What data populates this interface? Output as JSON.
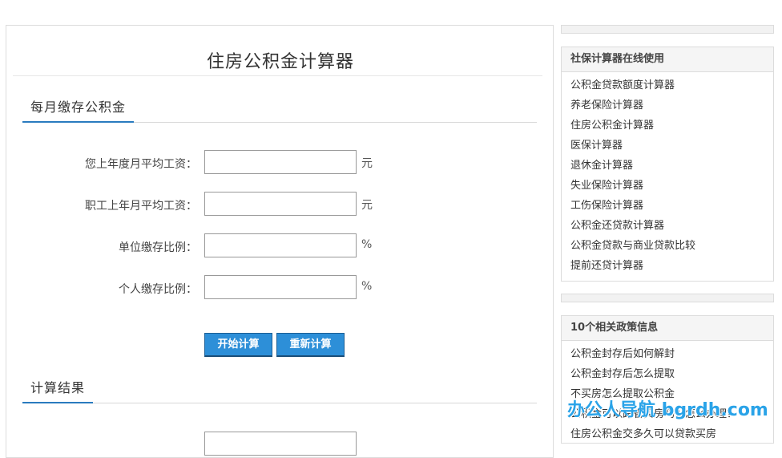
{
  "main": {
    "title": "住房公积金计算器",
    "section1": {
      "label": "每月缴存公积金"
    },
    "rows": [
      {
        "label": "您上年度月平均工资：",
        "value": "",
        "unit": "元"
      },
      {
        "label": "职工上年月平均工资：",
        "value": "",
        "unit": "元"
      },
      {
        "label": "单位缴存比例：",
        "value": "",
        "unit": "%"
      },
      {
        "label": "个人缴存比例：",
        "value": "",
        "unit": "%"
      }
    ],
    "buttons": {
      "calculate": "开始计算",
      "reset": "重新计算"
    },
    "section2": {
      "label": "计算结果"
    }
  },
  "sidebar": {
    "box1": {
      "title": "社保计算器在线使用",
      "items": [
        "公积金贷款额度计算器",
        "养老保险计算器",
        "住房公积金计算器",
        "医保计算器",
        "退休金计算器",
        "失业保险计算器",
        "工伤保险计算器",
        "公积金还贷款计算器",
        "公积金贷款与商业贷款比较",
        "提前还贷计算器"
      ]
    },
    "box2": {
      "title": "10个相关政策信息",
      "items": [
        "公积金封存后如何解封",
        "公积金封存后怎么提取",
        "不买房怎么提取公积金",
        "公积金可以跨省买房吗？怎么办理？",
        "住房公积金交多久可以贷款买房"
      ]
    }
  },
  "watermark": "办公人导航 bgrdh.com",
  "colors": {
    "accent": "#2a7bbf",
    "button": "#2d8fd8",
    "watermark": "#2aa3e8"
  }
}
